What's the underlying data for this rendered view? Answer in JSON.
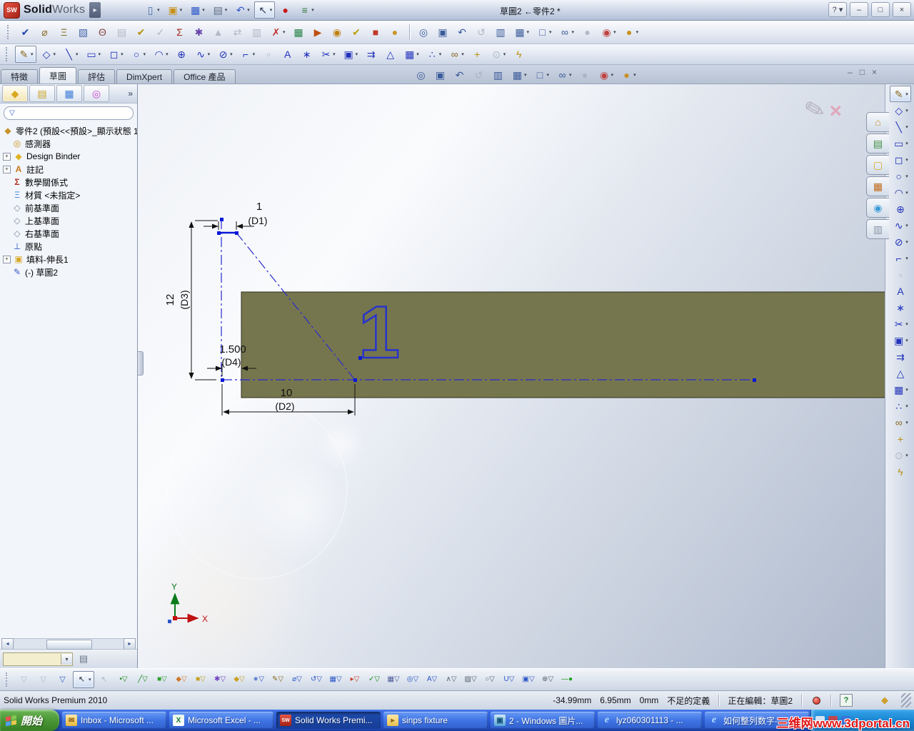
{
  "window": {
    "logo": {
      "part1": "Solid",
      "part2": "Works"
    },
    "menu_arrow": "▸",
    "title": "草圖2 ←零件2 *",
    "help": "?",
    "controls": {
      "minimize": "–",
      "restore": "□",
      "close": "×"
    }
  },
  "titlebar_icons": [
    {
      "name": "new-document-icon",
      "g": "▯",
      "c": "#4a6aa8",
      "dd": true
    },
    {
      "name": "open-document-icon",
      "g": "▣",
      "c": "#c89018",
      "dd": true
    },
    {
      "name": "save-icon",
      "g": "▦",
      "c": "#2a55c8",
      "dd": true
    },
    {
      "name": "print-icon",
      "g": "▤",
      "c": "#5a6a82",
      "dd": true
    },
    {
      "name": "undo-icon",
      "g": "↶",
      "c": "#2a55c8",
      "dd": true
    },
    {
      "name": "select-arrow-icon",
      "g": "↖",
      "c": "#2a3550",
      "active": true,
      "dd": true
    },
    {
      "name": "rebuild-stoplight-icon",
      "g": "●",
      "c": "#c81818"
    },
    {
      "name": "options-icon",
      "g": "≡",
      "c": "#3a7a3a",
      "dd": true
    }
  ],
  "toolbars": {
    "tools": [
      {
        "name": "spell-checker-icon",
        "g": "✔",
        "c": "#2244aa"
      },
      {
        "name": "measure-icon",
        "g": "⌀",
        "c": "#8a6a20"
      },
      {
        "name": "mass-properties-icon",
        "g": "Ξ",
        "c": "#8a6a20"
      },
      {
        "name": "section-properties-icon",
        "g": "▧",
        "c": "#4466aa"
      },
      {
        "name": "performance-evaluation-icon",
        "g": "Θ",
        "c": "#884444"
      },
      {
        "name": "statistics-icon",
        "g": "▤",
        "c": "#9aa",
        "dis": true
      },
      {
        "name": "check-active-document-icon",
        "g": "✔",
        "c": "#b89010"
      },
      {
        "name": "check-reference-icon",
        "g": "✓",
        "c": "#9aa",
        "dis": true
      },
      {
        "name": "equations-icon",
        "g": "Σ",
        "c": "#a02818"
      },
      {
        "name": "deviation-analysis-icon",
        "g": "✱",
        "c": "#6644aa"
      },
      {
        "name": "draft-analysis-icon",
        "g": "▲",
        "c": "#9aa",
        "dis": true
      },
      {
        "name": "symmetry-check-icon",
        "g": "⇄",
        "c": "#9aa",
        "dis": true
      },
      {
        "name": "compare-documents-icon",
        "g": "▥",
        "c": "#9aa",
        "dis": true
      },
      {
        "name": "check-sketch-for-feature-icon",
        "g": "✗",
        "c": "#c03030",
        "dd": true
      },
      {
        "name": "design-table-icon",
        "g": "▦",
        "c": "#208040"
      },
      {
        "name": "simulation-icon",
        "g": "▶",
        "c": "#c05010"
      },
      {
        "name": "motion-manager-icon",
        "g": "◉",
        "c": "#c08010"
      },
      {
        "name": "solidworks-checker-icon",
        "g": "✔",
        "c": "#b8a010"
      },
      {
        "name": "toolbox-addin-icon",
        "g": "■",
        "c": "#c03828"
      },
      {
        "name": "photoview-addin-icon",
        "g": "●",
        "c": "#c89828"
      }
    ],
    "view": [
      {
        "name": "zoom-to-fit-icon",
        "g": "◎",
        "c": "#3a5a9a"
      },
      {
        "name": "zoom-to-area-icon",
        "g": "▣",
        "c": "#3a5a9a"
      },
      {
        "name": "previous-view-icon",
        "g": "↶",
        "c": "#3a5a9a"
      },
      {
        "name": "rotate-view-icon",
        "g": "↺",
        "c": "#9aa",
        "dis": true
      },
      {
        "name": "section-view-icon",
        "g": "▥",
        "c": "#3a5a9a"
      },
      {
        "name": "view-orientation-icon",
        "g": "▦",
        "c": "#3a5a9a",
        "dd": true
      },
      {
        "name": "display-style-icon",
        "g": "□",
        "c": "#3a5a9a",
        "dd": true
      },
      {
        "name": "hide-show-items-icon",
        "g": "∞",
        "c": "#3a5a9a",
        "dd": true
      },
      {
        "name": "shadows-icon",
        "g": "●",
        "c": "#9aa",
        "dis": true
      },
      {
        "name": "apply-scene-icon",
        "g": "◉",
        "c": "#c04040",
        "dd": true
      },
      {
        "name": "render-icon",
        "g": "●",
        "c": "#c89020",
        "dd": true
      }
    ],
    "sketch": [
      {
        "name": "sketch-icon",
        "g": "✎",
        "c": "#8a6a20",
        "active": true,
        "dd": true
      },
      {
        "name": "smart-dimension-icon",
        "g": "◇",
        "c": "#2233bb",
        "dd": true
      },
      {
        "name": "line-icon",
        "g": "╲",
        "c": "#2233bb",
        "dd": true
      },
      {
        "name": "rectangle-icon",
        "g": "▭",
        "c": "#2233bb",
        "dd": true
      },
      {
        "name": "slot-icon",
        "g": "◻",
        "c": "#2233bb",
        "dd": true
      },
      {
        "name": "circle-icon",
        "g": "○",
        "c": "#2233bb",
        "dd": true
      },
      {
        "name": "arc-icon",
        "g": "◠",
        "c": "#2233bb",
        "dd": true
      },
      {
        "name": "polygon-icon",
        "g": "⊕",
        "c": "#2233bb"
      },
      {
        "name": "spline-icon",
        "g": "∿",
        "c": "#2233bb",
        "dd": true
      },
      {
        "name": "ellipse-icon",
        "g": "⊘",
        "c": "#2233bb",
        "dd": true
      },
      {
        "name": "sketch-fillet-icon",
        "g": "⌐",
        "c": "#2233bb",
        "dd": true
      },
      {
        "name": "selection-box-icon",
        "g": "▫",
        "c": "#9aa",
        "dis": true
      },
      {
        "name": "text-icon",
        "g": "A",
        "c": "#2233bb"
      },
      {
        "name": "point-icon",
        "g": "∗",
        "c": "#2233bb"
      },
      {
        "name": "trim-entities-icon",
        "g": "✂",
        "c": "#2233bb",
        "dd": true
      },
      {
        "name": "convert-entities-icon",
        "g": "▣",
        "c": "#2233bb",
        "dd": true
      },
      {
        "name": "offset-entities-icon",
        "g": "⇉",
        "c": "#2233bb"
      },
      {
        "name": "mirror-entities-icon",
        "g": "△",
        "c": "#2233bb"
      },
      {
        "name": "linear-sketch-pattern-icon",
        "g": "▦",
        "c": "#2233bb",
        "dd": true
      },
      {
        "name": "move-entities-icon",
        "g": "∴",
        "c": "#2233bb",
        "dd": true
      },
      {
        "name": "display-relations-icon",
        "g": "∞",
        "c": "#8a6a20",
        "dd": true
      },
      {
        "name": "repair-sketch-icon",
        "g": "+",
        "c": "#b89010"
      },
      {
        "name": "instant-2d-icon",
        "g": "⊙",
        "c": "#9aa",
        "dis": true,
        "dd": true
      },
      {
        "name": "rapid-sketch-icon",
        "g": "ϟ",
        "c": "#b89010"
      }
    ],
    "filters": [
      {
        "name": "filter-clear-icon",
        "g": "▽",
        "c": "#9aa2b0",
        "dis": true
      },
      {
        "name": "filter-clear-all-icon",
        "g": "▽",
        "c": "#9aa2b0",
        "dis": true
      },
      {
        "name": "filter-toggle-icon",
        "g": "▽",
        "c": "#2a55c8"
      },
      {
        "name": "select-tool-icon",
        "g": "↖",
        "c": "#223",
        "active": true,
        "dd": true
      },
      {
        "name": "select-other-icon",
        "g": "↖",
        "c": "#9aa2b0",
        "dis": true
      },
      {
        "name": "filter-vertices-icon",
        "g": "•▽",
        "c": "#208a20"
      },
      {
        "name": "filter-edges-icon",
        "g": "╱▽",
        "c": "#208a20"
      },
      {
        "name": "filter-faces-icon",
        "g": "■▽",
        "c": "#30a030"
      },
      {
        "name": "filter-surface-bodies-icon",
        "g": "◆▽",
        "c": "#d07828"
      },
      {
        "name": "filter-solid-bodies-icon",
        "g": "■▽",
        "c": "#c8a020"
      },
      {
        "name": "filter-quick-icon",
        "g": "✱▽",
        "c": "#7040c0"
      },
      {
        "name": "filter-axes-icon",
        "g": "◆▽",
        "c": "#c8a020"
      },
      {
        "name": "filter-points-icon",
        "g": "∗▽",
        "c": "#2a55c8"
      },
      {
        "name": "filter-sketches-icon",
        "g": "✎▽",
        "c": "#8a6a20"
      },
      {
        "name": "filter-dimensions-icon",
        "g": "⌀▽",
        "c": "#2a55c8"
      },
      {
        "name": "filter-rotate-icon",
        "g": "↺▽",
        "c": "#2a55c8"
      },
      {
        "name": "filter-patterns-icon",
        "g": "▦▽",
        "c": "#2a55c8"
      },
      {
        "name": "filter-datums-icon",
        "g": "▸▽",
        "c": "#c84028"
      },
      {
        "name": "filter-relations-icon",
        "g": "✓▽",
        "c": "#208a20"
      },
      {
        "name": "filter-tables-icon",
        "g": "▦▽",
        "c": "#4a5a9a"
      },
      {
        "name": "filter-magnify-notes-icon",
        "g": "◎▽",
        "c": "#2a55c8"
      },
      {
        "name": "filter-annotations-icon",
        "g": "A▽",
        "c": "#2a55c8"
      },
      {
        "name": "filter-welds-icon",
        "g": "∧▽",
        "c": "#555e6e"
      },
      {
        "name": "filter-hatch-icon",
        "g": "▨▽",
        "c": "#555e6e"
      },
      {
        "name": "filter-surface-finish-icon",
        "g": "○▽",
        "c": "#555e6e"
      },
      {
        "name": "filter-datum-targets-icon",
        "g": "U▽",
        "c": "#2a55c8"
      },
      {
        "name": "filter-blocks-icon",
        "g": "▣▽",
        "c": "#2a55c8"
      },
      {
        "name": "filter-balloons-icon",
        "g": "⊕▽",
        "c": "#555e6e"
      },
      {
        "name": "filter-connection-points-icon",
        "g": "—●",
        "c": "#20a020"
      }
    ]
  },
  "panel_tabs": [
    {
      "name": "featuremanager-tab-icon",
      "g": "◆",
      "c": "#d8a820",
      "active": true
    },
    {
      "name": "propertymanager-tab-icon",
      "g": "▤",
      "c": "#c8a020"
    },
    {
      "name": "configurationmanager-tab-icon",
      "g": "▦",
      "c": "#3a7ad8"
    },
    {
      "name": "dimxpertmanager-tab-icon",
      "g": "◎",
      "c": "#c840c8"
    }
  ],
  "panel": {
    "chevron": "»"
  },
  "taskpane": {
    "tabs": [
      {
        "name": "solidworks-resources-icon",
        "g": "⌂",
        "c": "#c89028"
      },
      {
        "name": "design-library-icon",
        "g": "▤",
        "c": "#3a8a3a"
      },
      {
        "name": "file-explorer-icon",
        "g": "▢",
        "c": "#d8a828"
      },
      {
        "name": "view-palette-icon",
        "g": "▦",
        "c": "#c06818"
      },
      {
        "name": "appearances-scenes-icon",
        "g": "◉",
        "c": "#3a9ad8"
      },
      {
        "name": "custom-properties-icon",
        "g": "▥",
        "c": "#8a94a8"
      }
    ]
  },
  "tabs": {
    "items": [
      {
        "label": "特徵"
      },
      {
        "label": "草圖"
      },
      {
        "label": "評估"
      },
      {
        "label": "DimXpert"
      },
      {
        "label": "Office 產品"
      }
    ]
  },
  "feature_tree": {
    "root": "零件2 (預設<<預設>_顯示狀態 1",
    "items": [
      {
        "label": "感測器"
      },
      {
        "label": "Design Binder"
      },
      {
        "label": "註記"
      },
      {
        "label": "數學關係式"
      },
      {
        "label": "材質 <未指定>"
      },
      {
        "label": "前基準面"
      },
      {
        "label": "上基準面"
      },
      {
        "label": "右基準面"
      },
      {
        "label": "原點"
      },
      {
        "label": "填料-伸長1"
      },
      {
        "label": "(-) 草圖2"
      }
    ],
    "expand_glyph": "+"
  },
  "sketch": {
    "embedded_text": "1",
    "dims": {
      "d1": {
        "value": "1",
        "label": "(D1)"
      },
      "d2": {
        "value": "10",
        "label": "(D2)"
      },
      "d3": {
        "value": "12",
        "label": "(D3)"
      },
      "d4": {
        "value": "1.500",
        "label": "(D4)"
      }
    },
    "part_color": "#76764e",
    "sketch_blue": "#1522cc",
    "axis": {
      "x": "X",
      "y": "Y"
    }
  },
  "status": {
    "left": "Solid Works Premium 2010",
    "x": "-34.99mm",
    "y": "6.95mm",
    "z": "0mm",
    "defined": "不足的定義",
    "editing": "正在編輯：草圖2",
    "help": "?"
  },
  "taskbar": {
    "start_label": "開始",
    "buttons": [
      {
        "label": "Inbox - Microsoft ..."
      },
      {
        "label": "Microsoft Excel - ..."
      },
      {
        "label": "Solid Works Premi..."
      },
      {
        "label": "sinps fixture"
      },
      {
        "label": "2 - Windows 圖片..."
      },
      {
        "label": "lyz060301113 - ..."
      },
      {
        "label": "如何整列数字-..."
      }
    ],
    "button_icon_labels": {
      "outlook": "✉",
      "excel": "X",
      "solidworks": "SW",
      "ie": "e",
      "picture": "▣"
    },
    "watermark": "三维网www.3dportal.cn"
  }
}
